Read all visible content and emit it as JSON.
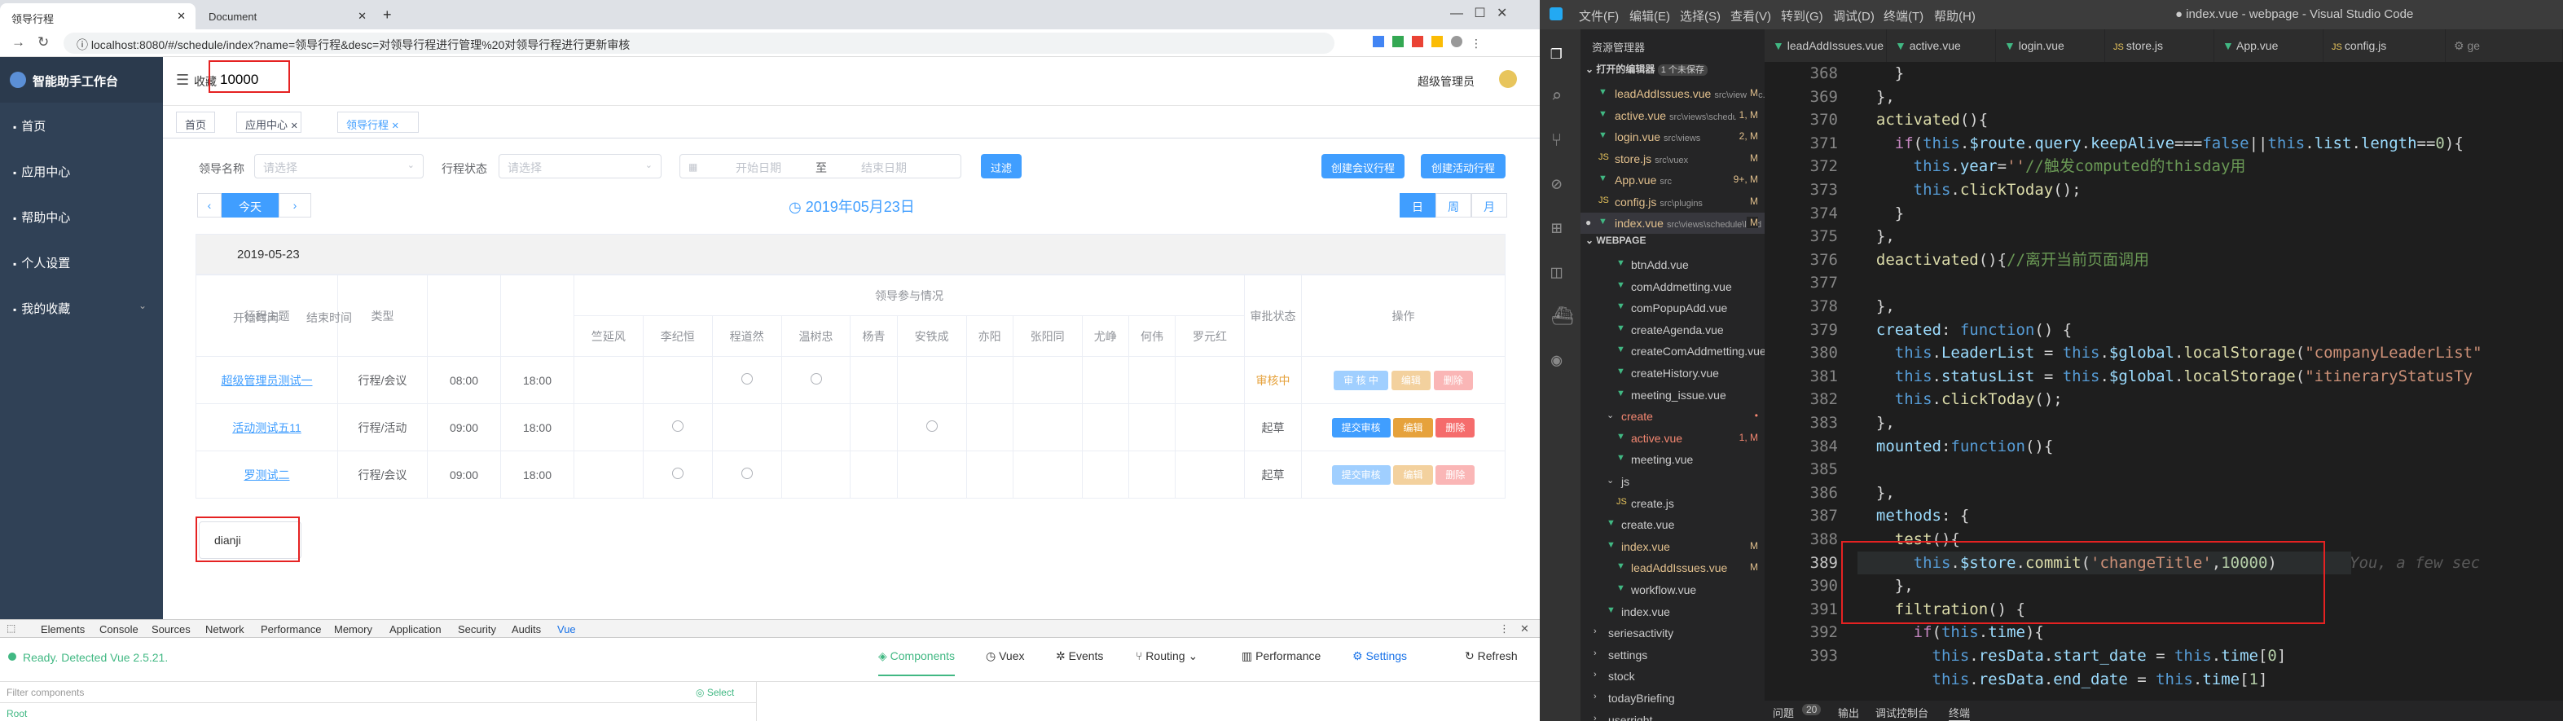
{
  "browser": {
    "tabs": [
      {
        "label": "领导行程"
      },
      {
        "label": "Document"
      }
    ],
    "url": "localhost:8080/#/schedule/index?name=领导行程&desc=对领导行程进行管理%20对领导行程进行更新审核"
  },
  "app": {
    "title": "智能助手工作台",
    "sidebar": [
      {
        "label": "首页"
      },
      {
        "label": "应用中心"
      },
      {
        "label": "帮助中心"
      },
      {
        "label": "个人设置"
      },
      {
        "label": "我的收藏"
      }
    ],
    "header": {
      "collect_label": "收藏",
      "title_value": "10000",
      "user": "超级管理员"
    },
    "tags": [
      {
        "label": "首页"
      },
      {
        "label": "应用中心"
      },
      {
        "label": "领导行程"
      }
    ],
    "filters": {
      "leader_label": "领导名称",
      "leader_placeholder": "请选择",
      "status_label": "行程状态",
      "status_placeholder": "请选择",
      "start_placeholder": "开始日期",
      "range_sep": "至",
      "end_placeholder": "结束日期",
      "filter_button": "过滤",
      "create_meeting": "创建会议行程",
      "create_activity": "创建活动行程"
    },
    "nav": {
      "prev": "‹",
      "today": "今天",
      "next": "›",
      "date_title": "2019年05月23日",
      "day": "日",
      "week": "周",
      "month": "月"
    },
    "table": {
      "date": "2019-05-23",
      "h_subject": "行程主题",
      "h_type": "类型",
      "h_start": "开始时间",
      "h_end": "结束时间",
      "h_group": "领导参与情况",
      "h_status": "审批状态",
      "h_ops": "操作",
      "leaders": [
        "竺延风",
        "李纪恒",
        "程道然",
        "温树忠",
        "杨青",
        "安铁成",
        "亦阳",
        "张阳同",
        "尤峥",
        "何伟",
        "罗元红"
      ],
      "rows": [
        {
          "subject": "超级管理员测试一",
          "type": "行程/会议",
          "start": "08:00",
          "end": "18:00",
          "status": "审核中",
          "b1": "审 核 中",
          "b2": "编辑",
          "b3": "删除"
        },
        {
          "subject": "活动测试五11",
          "type": "行程/活动",
          "start": "09:00",
          "end": "18:00",
          "status": "起草",
          "b1": "提交审核",
          "b2": "编辑",
          "b3": "删除"
        },
        {
          "subject": "罗测试二",
          "type": "行程/会议",
          "start": "09:00",
          "end": "18:00",
          "status": "起草",
          "b1": "提交审核",
          "b2": "编辑",
          "b3": "删除"
        }
      ]
    },
    "test_box": "dianji"
  },
  "devtools": {
    "tabs": [
      "Elements",
      "Console",
      "Sources",
      "Network",
      "Performance",
      "Memory",
      "Application",
      "Security",
      "Audits",
      "Vue"
    ],
    "status": "Ready. Detected Vue 2.5.21.",
    "vue_tabs": [
      "Components",
      "Vuex",
      "Events",
      "Routing",
      "Performance",
      "Settings",
      "Refresh"
    ],
    "filter_placeholder": "Filter components",
    "select": "Select",
    "root": "Root"
  },
  "vscode": {
    "menu": [
      "文件(F)",
      "编辑(E)",
      "选择(S)",
      "查看(V)",
      "转到(G)",
      "调试(D)",
      "终端(T)",
      "帮助(H)"
    ],
    "window_title": "● index.vue - webpage - Visual Studio Code",
    "explorer_title": "资源管理器",
    "open_editors": "打开的编辑器",
    "unsaved": "1 个未保存",
    "open_files": [
      {
        "name": "leadAddIssues.vue",
        "path": "src\\views\\sc...",
        "st": "M"
      },
      {
        "name": "active.vue",
        "path": "src\\views\\schedule\\...",
        "st": "1, M"
      },
      {
        "name": "login.vue",
        "path": "src\\views",
        "st": "2, M"
      },
      {
        "name": "store.js",
        "path": "src\\vuex",
        "st": "M"
      },
      {
        "name": "App.vue",
        "path": "src",
        "st": "9+, M"
      },
      {
        "name": "config.js",
        "path": "src\\plugins",
        "st": "M"
      },
      {
        "name": "index.vue",
        "path": "src\\views\\schedule\\lead",
        "st": "M"
      }
    ],
    "workspace": "WEBPAGE",
    "tree": [
      {
        "name": "btnAdd.vue",
        "st": ""
      },
      {
        "name": "comAddmetting.vue",
        "st": ""
      },
      {
        "name": "comPopupAdd.vue",
        "st": ""
      },
      {
        "name": "createAgenda.vue",
        "st": ""
      },
      {
        "name": "createComAddmetting.vue",
        "st": ""
      },
      {
        "name": "createHistory.vue",
        "st": ""
      },
      {
        "name": "meeting_issue.vue",
        "st": ""
      },
      {
        "name": "create",
        "st": "•"
      },
      {
        "name": "active.vue",
        "st": "1, M"
      },
      {
        "name": "meeting.vue",
        "st": ""
      },
      {
        "name": "js",
        "st": ""
      },
      {
        "name": "create.js",
        "st": ""
      },
      {
        "name": "create.vue",
        "st": ""
      },
      {
        "name": "index.vue",
        "st": "M"
      },
      {
        "name": "leadAddIssues.vue",
        "st": "M"
      },
      {
        "name": "workflow.vue",
        "st": ""
      },
      {
        "name": "index.vue",
        "st": ""
      },
      {
        "name": "seriesactivity",
        "st": ""
      },
      {
        "name": "settings",
        "st": ""
      },
      {
        "name": "stock",
        "st": ""
      },
      {
        "name": "todayBriefing",
        "st": ""
      },
      {
        "name": "userright",
        "st": ""
      }
    ],
    "editor_tabs": [
      "leadAddIssues.vue",
      "active.vue",
      "login.vue",
      "store.js",
      "App.vue",
      "config.js"
    ],
    "line_numbers": [
      "368",
      "369",
      "370",
      "371",
      "372",
      "373",
      "374",
      "375",
      "376",
      "377",
      "378",
      "379",
      "380",
      "381",
      "382",
      "383",
      "384",
      "385",
      "386",
      "387",
      "388",
      "389",
      "390",
      "391",
      "392",
      "393"
    ],
    "ghost": "You, a few sec",
    "status_tabs": [
      "问题",
      "20",
      "输出",
      "调试控制台",
      "终端"
    ]
  }
}
